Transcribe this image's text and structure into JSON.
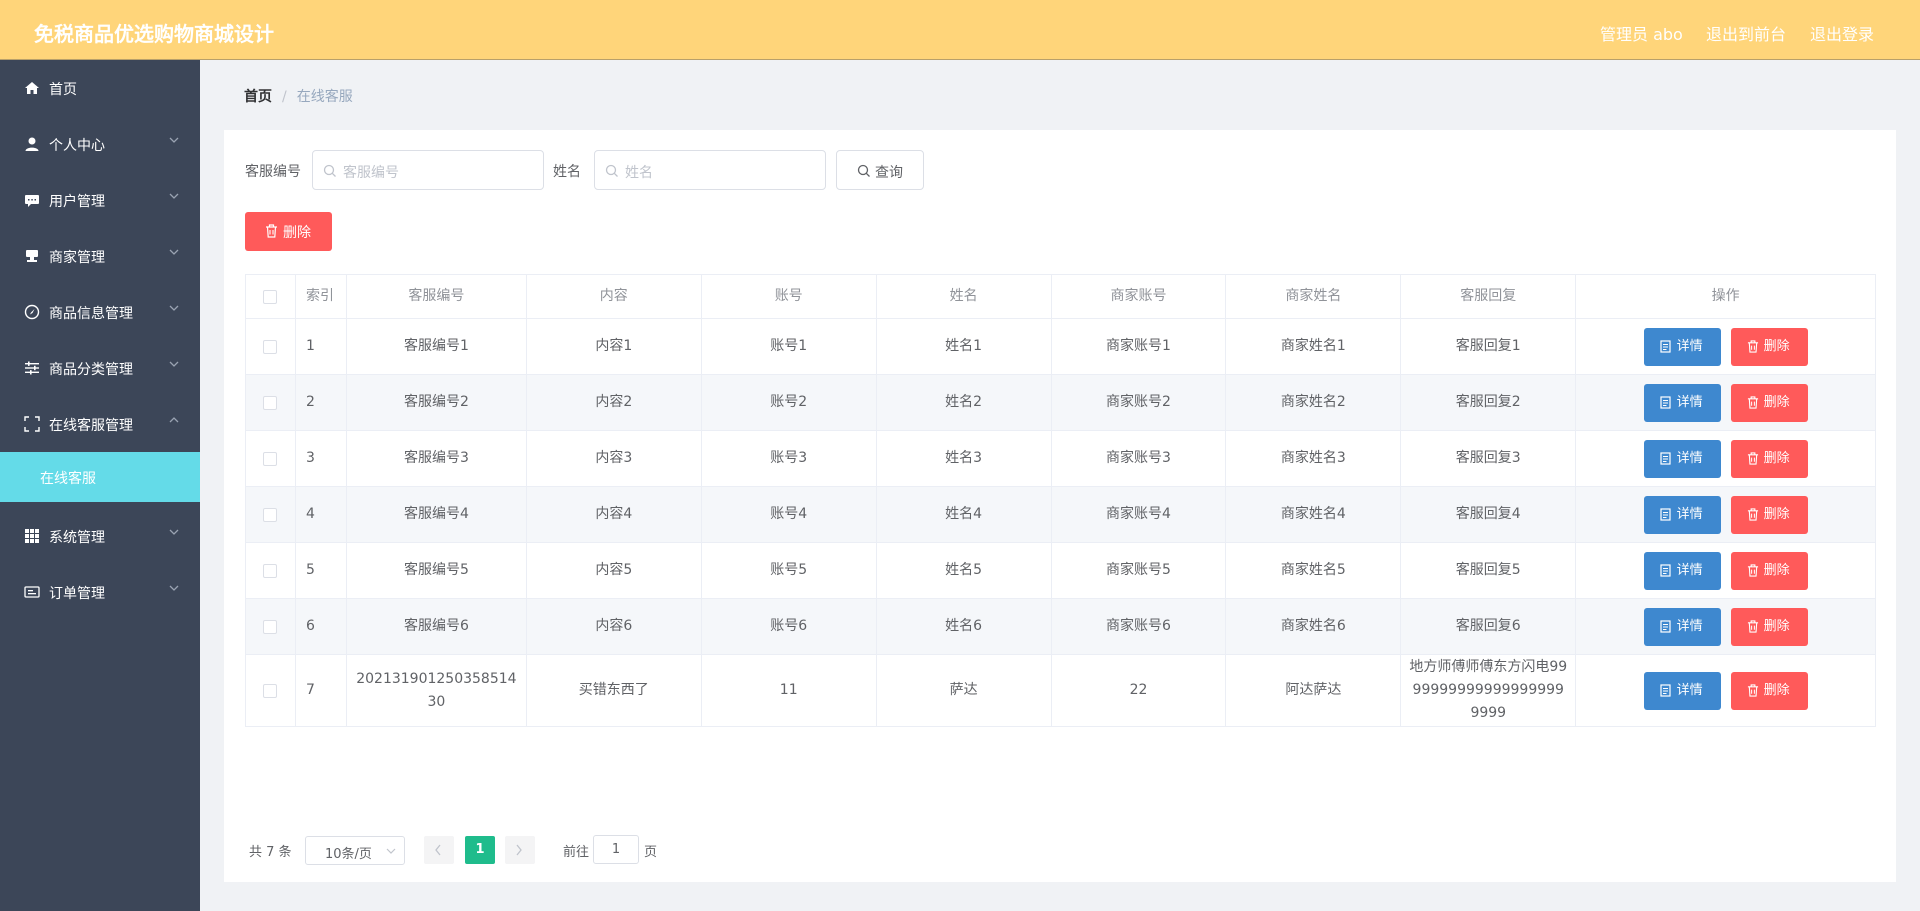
{
  "header": {
    "app_title": "免税商品优选购物商城设计",
    "user": "管理员 abo",
    "to_front": "退出到前台",
    "logout": "退出登录"
  },
  "sidebar": {
    "items": [
      {
        "label": "首页",
        "icon": "home-icon"
      },
      {
        "label": "个人中心",
        "icon": "user-icon"
      },
      {
        "label": "用户管理",
        "icon": "message-icon"
      },
      {
        "label": "商家管理",
        "icon": "stamp-icon"
      },
      {
        "label": "商品信息管理",
        "icon": "compass-icon"
      },
      {
        "label": "商品分类管理",
        "icon": "sliders-icon"
      },
      {
        "label": "在线客服管理",
        "icon": "fullscreen-icon"
      },
      {
        "label": "系统管理",
        "icon": "grid-icon"
      },
      {
        "label": "订单管理",
        "icon": "tickets-icon"
      }
    ],
    "active_sub": "在线客服"
  },
  "breadcrumb": {
    "home": "首页",
    "current": "在线客服"
  },
  "search": {
    "field1_label": "客服编号",
    "field1_placeholder": "客服编号",
    "field2_label": "姓名",
    "field2_placeholder": "姓名",
    "query_label": "查询"
  },
  "actions": {
    "delete_label": "删除"
  },
  "table": {
    "headers": [
      "索引",
      "客服编号",
      "内容",
      "账号",
      "姓名",
      "商家账号",
      "商家姓名",
      "客服回复",
      "操作"
    ],
    "detail_label": "详情",
    "delete_label": "删除",
    "rows": [
      [
        "1",
        "客服编号1",
        "内容1",
        "账号1",
        "姓名1",
        "商家账号1",
        "商家姓名1",
        "客服回复1"
      ],
      [
        "2",
        "客服编号2",
        "内容2",
        "账号2",
        "姓名2",
        "商家账号2",
        "商家姓名2",
        "客服回复2"
      ],
      [
        "3",
        "客服编号3",
        "内容3",
        "账号3",
        "姓名3",
        "商家账号3",
        "商家姓名3",
        "客服回复3"
      ],
      [
        "4",
        "客服编号4",
        "内容4",
        "账号4",
        "姓名4",
        "商家账号4",
        "商家姓名4",
        "客服回复4"
      ],
      [
        "5",
        "客服编号5",
        "内容5",
        "账号5",
        "姓名5",
        "商家账号5",
        "商家姓名5",
        "客服回复5"
      ],
      [
        "6",
        "客服编号6",
        "内容6",
        "账号6",
        "姓名6",
        "商家账号6",
        "商家姓名6",
        "客服回复6"
      ],
      [
        "7",
        "20213190125035851430",
        "买错东西了",
        "11",
        "萨达",
        "22",
        "阿达萨达",
        "地方师傅师傅东方闪电99999999999999999999999"
      ]
    ]
  },
  "pagination": {
    "total": "共 7 条",
    "page_size": "10条/页",
    "current": "1",
    "goto": "前往",
    "jump_value": "1",
    "page_suffix": "页"
  },
  "colors": {
    "header_bg": "#ffd57a",
    "sidebar_bg": "#3c4658",
    "active_sub_bg": "#64dbe8",
    "detail_btn": "#3e88cf",
    "delete_btn": "#ff5a5a",
    "pager_active": "#1fbc8c"
  }
}
